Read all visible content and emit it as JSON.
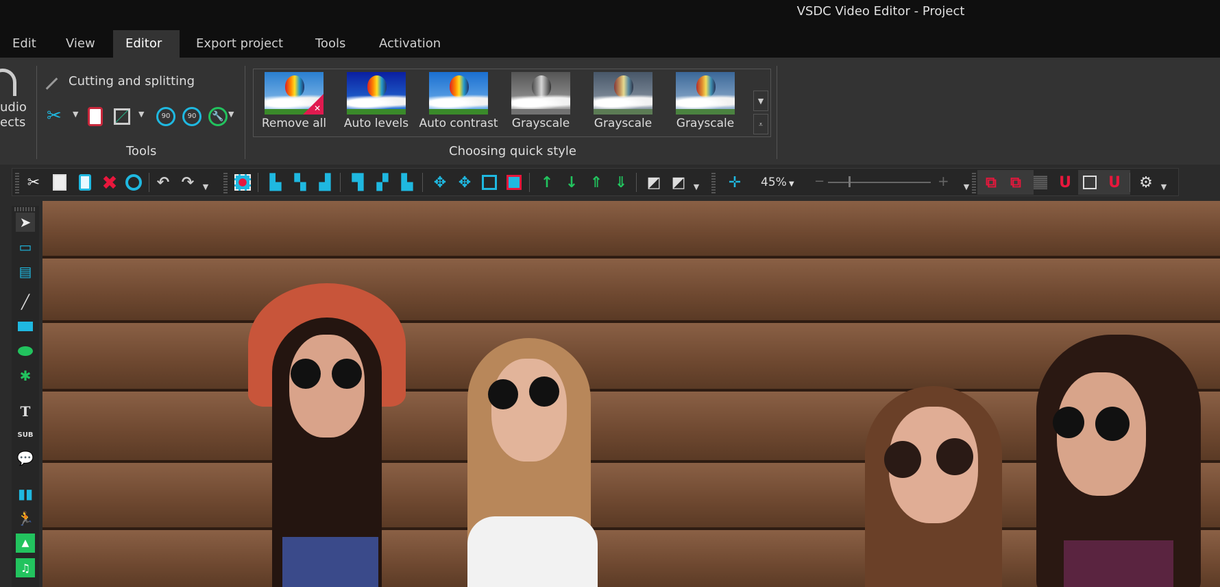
{
  "window": {
    "title": "VSDC Video Editor - Project"
  },
  "menu": {
    "tabs": [
      {
        "label": "Edit"
      },
      {
        "label": "View"
      },
      {
        "label": "Editor"
      },
      {
        "label": "Export project"
      },
      {
        "label": "Tools"
      },
      {
        "label": "Activation"
      }
    ],
    "active": "Editor"
  },
  "ribbon": {
    "audio_effects": {
      "label_line1": "udio",
      "label_line2": "ects"
    },
    "tools": {
      "cutting_label": "Cutting and splitting",
      "group_label": "Tools",
      "rotate_left": "90",
      "rotate_right": "90"
    },
    "quick_style": {
      "group_label": "Choosing quick style",
      "items": [
        {
          "label": "Remove all"
        },
        {
          "label": "Auto levels"
        },
        {
          "label": "Auto contrast"
        },
        {
          "label": "Grayscale"
        },
        {
          "label": "Grayscale"
        },
        {
          "label": "Grayscale"
        }
      ]
    }
  },
  "toolbar": {
    "zoom": "45%"
  },
  "colors": {
    "accent_cyan": "#1fb8e0",
    "delete_red": "#e8173c",
    "green": "#22c35e",
    "bg": "#333333"
  }
}
